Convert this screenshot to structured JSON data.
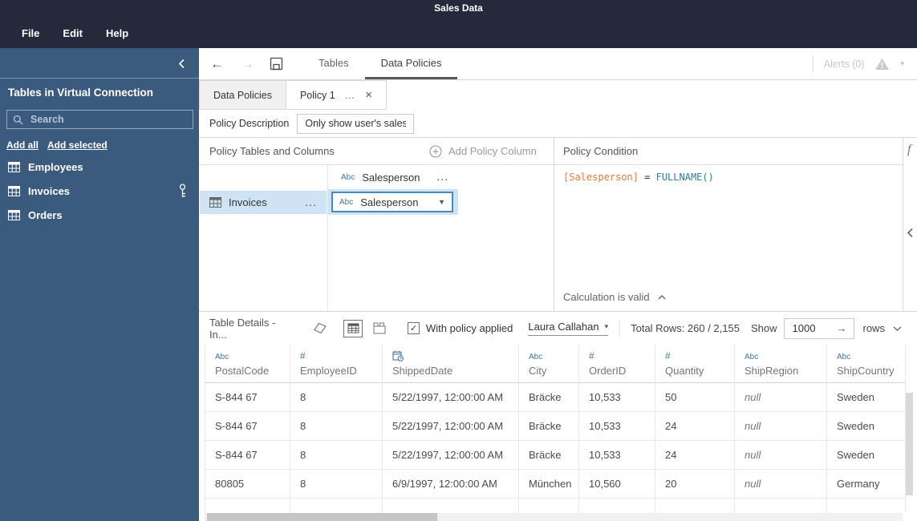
{
  "colors": {
    "topbar_bg": "#242a3c",
    "sidebar_bg": "#3a5a7e",
    "selection_highlight": "#cfe3f5",
    "accent_blue": "#4a89c0",
    "type_icon_blue": "#4576a4",
    "code_field_orange": "#e87a3e",
    "code_function_teal": "#2e7d9c"
  },
  "icons": {
    "more": "…",
    "close": "×",
    "back": "←",
    "forward": "→",
    "dropdown": "▼",
    "caret": "▾",
    "check": "✓",
    "function": "f"
  },
  "titlebar": {
    "title": "Sales Data",
    "menus": [
      "File",
      "Edit",
      "Help"
    ]
  },
  "toolbar": {
    "nav_tabs": [
      {
        "label": "Tables",
        "active": false
      },
      {
        "label": "Data Policies",
        "active": true
      }
    ],
    "alerts_label": "Alerts (0)"
  },
  "sidebar": {
    "header": "Tables in Virtual Connection",
    "search_placeholder": "Search",
    "links": [
      "Add all",
      "Add selected"
    ],
    "tables": [
      {
        "name": "Employees",
        "has_key": false
      },
      {
        "name": "Invoices",
        "has_key": true
      },
      {
        "name": "Orders",
        "has_key": false
      }
    ]
  },
  "policy_tabs": [
    {
      "label": "Data Policies",
      "active": false
    },
    {
      "label": "Policy 1",
      "active": true
    }
  ],
  "policy": {
    "description_label": "Policy Description",
    "description_value": "Only show user's sales",
    "tables_header": "Policy Tables and Columns",
    "add_column_label": "Add Policy Column",
    "condition_header": "Policy Condition",
    "policy_column": {
      "type": "Abc",
      "name": "Salesperson"
    },
    "table_mapping": {
      "table": "Invoices",
      "column_type": "Abc",
      "column": "Salesperson"
    },
    "condition_code": [
      {
        "text": "[Salesperson]",
        "color": "#e87a3e"
      },
      {
        "text": " = ",
        "color": "#333333"
      },
      {
        "text": "FULLNAME()",
        "color": "#2e7d9c"
      }
    ],
    "validation_status": "Calculation is valid"
  },
  "table_details": {
    "title": "Table Details - In...",
    "with_policy_label": "With policy applied",
    "policy_checked": true,
    "user": "Laura Callahan",
    "total_rows": "Total Rows: 260 / 2,155",
    "show_label": "Show",
    "rows_value": "1000",
    "rows_label": "rows"
  },
  "data_grid": {
    "columns": [
      {
        "name": "PostalCode",
        "type": "Abc"
      },
      {
        "name": "EmployeeID",
        "type": "#"
      },
      {
        "name": "ShippedDate",
        "type": "date"
      },
      {
        "name": "City",
        "type": "Abc"
      },
      {
        "name": "OrderID",
        "type": "#"
      },
      {
        "name": "Quantity",
        "type": "#"
      },
      {
        "name": "ShipRegion",
        "type": "Abc"
      },
      {
        "name": "ShipCountry",
        "type": "Abc"
      }
    ],
    "rows": [
      [
        "S-844 67",
        "8",
        "5/22/1997, 12:00:00 AM",
        "Bräcke",
        "10,533",
        "50",
        "null",
        "Sweden"
      ],
      [
        "S-844 67",
        "8",
        "5/22/1997, 12:00:00 AM",
        "Bräcke",
        "10,533",
        "24",
        "null",
        "Sweden"
      ],
      [
        "S-844 67",
        "8",
        "5/22/1997, 12:00:00 AM",
        "Bräcke",
        "10,533",
        "24",
        "null",
        "Sweden"
      ],
      [
        "80805",
        "8",
        "6/9/1997, 12:00:00 AM",
        "München",
        "10,560",
        "20",
        "null",
        "Germany"
      ]
    ]
  }
}
